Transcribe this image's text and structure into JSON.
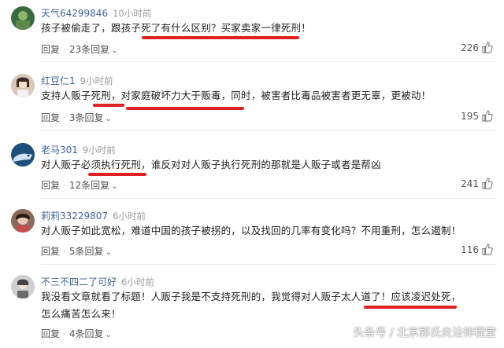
{
  "comments": [
    {
      "username": "天气64299846",
      "time": "10小时前",
      "text": "孩子被偷走了，跟孩子死了有什么区别？买家卖家一律死刑！",
      "reply_label": "回复",
      "replies": "23条回复",
      "likes": "226"
    },
    {
      "username": "红豆仁1",
      "time": "9小时前",
      "text": "支持人贩子死刑，对家庭破坏力大于贩毒，同时，被害者比毒品被害者更无辜，更被动！",
      "reply_label": "回复",
      "replies": "3条回复",
      "likes": "195"
    },
    {
      "username": "老马301",
      "time": "9小时前",
      "text": "对人贩子必须执行死刑，谁反对对人贩子执行死刑的那就是人贩子或者是帮凶",
      "reply_label": "回复",
      "replies": "12条回复",
      "likes": "241"
    },
    {
      "username": "莉莉33229807",
      "time": "6小时前",
      "text": "对人贩子如此宽松，难道中国的孩子被拐的，以及找回的几率有变化吗？不用重刑，怎么遏制！",
      "reply_label": "回复",
      "replies": "5条回复",
      "likes": "116"
    },
    {
      "username": "不三不四二了可好",
      "time": "6小时前",
      "text": "我没看文章就看了标题！人贩子我是不支持死刑的，我觉得对人贩子太人道了！应该凌迟处死，怎么痛苦怎么来！",
      "reply_label": "回复",
      "replies": "4条回复",
      "likes": ""
    }
  ],
  "watermark": "头条号 / 北京郭氏炎法律程堂",
  "colors": {
    "username": "#406599",
    "underline": "#e02020",
    "meta": "#999999"
  },
  "icons": {
    "like": "thumbs-up-icon",
    "expand": "chevron-down-icon"
  }
}
